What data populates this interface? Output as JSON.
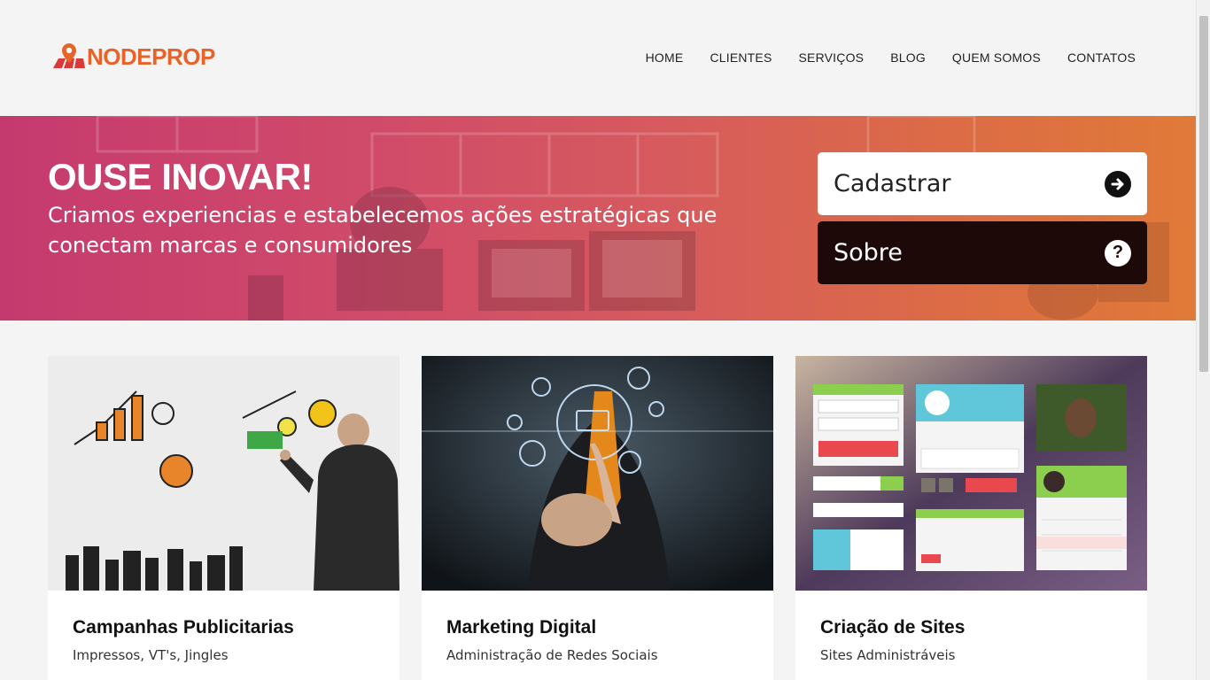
{
  "brand": {
    "name": "NODEPROP",
    "color": "#e8632a"
  },
  "nav": {
    "items": [
      "HOME",
      "CLIENTES",
      "SERVIÇOS",
      "BLOG",
      "QUEM SOMOS",
      "CONTATOS"
    ]
  },
  "hero": {
    "title": "OUSE INOVAR!",
    "subtitle": "Criamos experiencias e estabelecemos ações estratégicas que conectam marcas e consumidores",
    "register_label": "Cadastrar",
    "register_icon": "arrow-right-circle-icon",
    "about_label": "Sobre",
    "about_icon": "question-circle-icon"
  },
  "cards": [
    {
      "title": "Campanhas Publicitarias",
      "description": "Impressos, VT's, Jingles"
    },
    {
      "title": "Marketing Digital",
      "description": "Administração de Redes Sociais"
    },
    {
      "title": "Criação de Sites",
      "description": "Sites Administráveis"
    }
  ]
}
